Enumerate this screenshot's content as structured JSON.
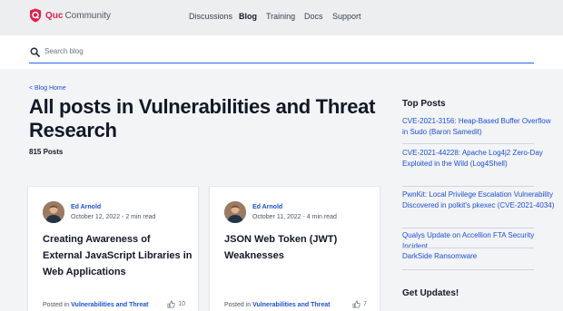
{
  "header": {
    "logo_text": "Quc",
    "logo_subtext": "Community",
    "brand_color": "#e11d48",
    "nav": [
      {
        "label": "Discussions",
        "active": false
      },
      {
        "label": "Blog",
        "active": true
      },
      {
        "label": "Training",
        "active": false
      },
      {
        "label": "Docs",
        "active": false
      },
      {
        "label": "Support",
        "active": false
      }
    ]
  },
  "search": {
    "placeholder": "Search blog",
    "icon": "search-icon"
  },
  "main": {
    "breadcrumb": "< Blog Home",
    "title": "All posts in Vulnerabilities and Threat Research",
    "post_count": "815 Posts",
    "cards": [
      {
        "author": "Ed Arnold",
        "meta": "October 12, 2022 - 2 min read",
        "title": "Creating Awareness of External JavaScript Libraries in Web Applications",
        "posted_prefix": "Posted in",
        "category": "Vulnerabilities and Threat",
        "likes": "10"
      },
      {
        "author": "Ed Arnold",
        "meta": "October 11, 2022 - 4 min read",
        "title": "JSON Web Token (JWT) Weaknesses",
        "posted_prefix": "Posted in",
        "category": "Vulnerabilities and Threat",
        "likes": "7"
      }
    ]
  },
  "sidebar": {
    "top_posts_heading": "Top Posts",
    "top_posts": [
      "CVE-2021-3156: Heap-Based Buffer Overflow in Sudo (Baron Samedit)",
      "CVE-2021-44228: Apache Log4j2 Zero-Day Exploited in the Wild (Log4Shell)",
      "PwnKit: Local Privilege Escalation Vulnerability Discovered in polkit's pkexec (CVE-2021-4034)",
      "Qualys Update on Accellion FTA Security Incident",
      "DarkSide Ransomware"
    ],
    "updates_heading": "Get Updates!"
  }
}
